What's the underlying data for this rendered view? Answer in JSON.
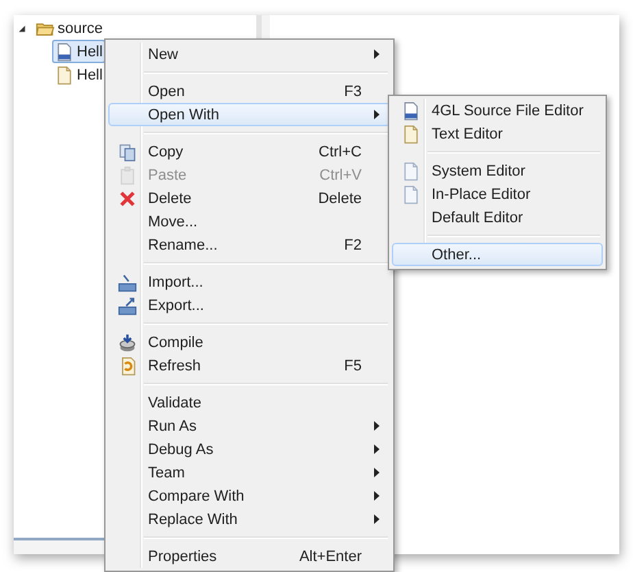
{
  "tree": {
    "items": [
      {
        "label": "source",
        "expanded": true,
        "selected": false,
        "children": [
          {
            "label": "Hell",
            "selected": true
          },
          {
            "label": "Hell",
            "selected": false
          }
        ]
      }
    ]
  },
  "context_menu": {
    "items": [
      {
        "kind": "item",
        "label": "New",
        "submenu": true,
        "disabled": false,
        "selected": false
      },
      {
        "kind": "separator"
      },
      {
        "kind": "item",
        "label": "Open",
        "shortcut": "F3",
        "submenu": false,
        "disabled": false,
        "selected": false
      },
      {
        "kind": "item",
        "label": "Open With",
        "submenu": true,
        "disabled": false,
        "selected": true
      },
      {
        "kind": "separator"
      },
      {
        "kind": "item",
        "label": "Copy",
        "shortcut": "Ctrl+C",
        "submenu": false,
        "disabled": false,
        "selected": false
      },
      {
        "kind": "item",
        "label": "Paste",
        "shortcut": "Ctrl+V",
        "submenu": false,
        "disabled": true,
        "selected": false
      },
      {
        "kind": "item",
        "label": "Delete",
        "shortcut": "Delete",
        "submenu": false,
        "disabled": false,
        "selected": false
      },
      {
        "kind": "item",
        "label": "Move...",
        "submenu": false,
        "disabled": false,
        "selected": false
      },
      {
        "kind": "item",
        "label": "Rename...",
        "shortcut": "F2",
        "submenu": false,
        "disabled": false,
        "selected": false
      },
      {
        "kind": "separator"
      },
      {
        "kind": "item",
        "label": "Import...",
        "submenu": false,
        "disabled": false,
        "selected": false
      },
      {
        "kind": "item",
        "label": "Export...",
        "submenu": false,
        "disabled": false,
        "selected": false
      },
      {
        "kind": "separator"
      },
      {
        "kind": "item",
        "label": "Compile",
        "submenu": false,
        "disabled": false,
        "selected": false
      },
      {
        "kind": "item",
        "label": "Refresh",
        "shortcut": "F5",
        "submenu": false,
        "disabled": false,
        "selected": false
      },
      {
        "kind": "separator"
      },
      {
        "kind": "item",
        "label": "Validate",
        "submenu": false,
        "disabled": false,
        "selected": false
      },
      {
        "kind": "item",
        "label": "Run As",
        "submenu": true,
        "disabled": false,
        "selected": false
      },
      {
        "kind": "item",
        "label": "Debug As",
        "submenu": true,
        "disabled": false,
        "selected": false
      },
      {
        "kind": "item",
        "label": "Team",
        "submenu": true,
        "disabled": false,
        "selected": false
      },
      {
        "kind": "item",
        "label": "Compare With",
        "submenu": true,
        "disabled": false,
        "selected": false
      },
      {
        "kind": "item",
        "label": "Replace With",
        "submenu": true,
        "disabled": false,
        "selected": false
      },
      {
        "kind": "separator"
      },
      {
        "kind": "item",
        "label": "Properties",
        "shortcut": "Alt+Enter",
        "submenu": false,
        "disabled": false,
        "selected": false
      }
    ]
  },
  "submenu": {
    "items": [
      {
        "kind": "item",
        "label": "4GL Source File Editor",
        "selected": false
      },
      {
        "kind": "item",
        "label": "Text Editor",
        "selected": false
      },
      {
        "kind": "separator"
      },
      {
        "kind": "item",
        "label": "System Editor",
        "selected": false
      },
      {
        "kind": "item",
        "label": "In-Place Editor",
        "selected": false
      },
      {
        "kind": "item",
        "label": "Default Editor",
        "selected": false
      },
      {
        "kind": "separator"
      },
      {
        "kind": "item",
        "label": "Other...",
        "selected": true
      }
    ]
  }
}
